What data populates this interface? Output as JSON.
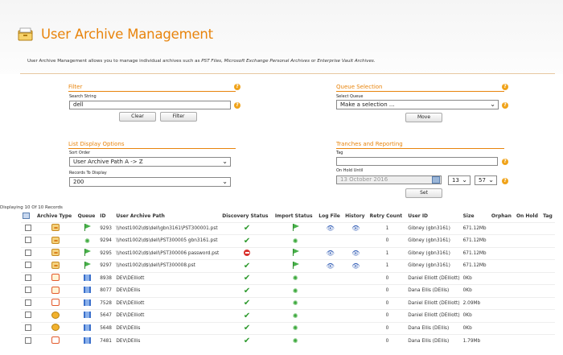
{
  "page": {
    "title": "User Archive Management",
    "description_prefix": "User Archive Management allows you to manage individual archives such as ",
    "description_pst": "PST Files, Microsoft Exchange Personal Archives",
    "description_or": " or ",
    "description_ev": "Enterprise Vault Archives.",
    "accent_color": "#e8840c"
  },
  "filter": {
    "title": "Filter",
    "search_label": "Search String",
    "search_value": "dell",
    "clear_label": "Clear",
    "filter_label": "Filter"
  },
  "queue": {
    "title": "Queue Selection",
    "select_label": "Select Queue",
    "select_value": "Make a selection ...",
    "move_label": "Move"
  },
  "display": {
    "title": "List Display Options",
    "sort_label": "Sort Order",
    "sort_value": "User Archive Path A -> Z",
    "records_label": "Records To Display",
    "records_value": "200"
  },
  "tranches": {
    "title": "Tranches and Reporting",
    "tag_label": "Tag",
    "tag_value": "",
    "hold_label": "On Hold Until",
    "hold_date": "13 October 2016",
    "hour": "13",
    "minute": "57",
    "set_label": "Set"
  },
  "help_glyph": "?",
  "records_count": "Displaying 10 Of 10 Records",
  "table": {
    "columns": [
      "Archive Type",
      "Queue",
      "ID",
      "User Archive Path",
      "Discovery Status",
      "Import Status",
      "Log File",
      "History",
      "Retry Count",
      "User ID",
      "Size",
      "Orphan",
      "On Hold",
      "Tag"
    ],
    "rows": [
      {
        "type": "pst",
        "queue": "flag",
        "id": "9293",
        "path": "\\\\host1002\\d$\\dell\\gbn3161\\PST300001.pst",
        "discovery": "check",
        "import": "flag",
        "log": true,
        "history": true,
        "retry": "1",
        "user": "Gibney (gbn3161)",
        "size": "671.12Mb"
      },
      {
        "type": "pst",
        "queue": "gear",
        "id": "9294",
        "path": "\\\\host1002\\d$\\dell\\PST300005 gbn3161.pst",
        "discovery": "check",
        "import": "gear",
        "log": false,
        "history": false,
        "retry": "0",
        "user": "Gibney (gbn3161)",
        "size": "671.12Mb"
      },
      {
        "type": "pst",
        "queue": "flag",
        "id": "9295",
        "path": "\\\\host1002\\d$\\dell\\PST300006 password.pst",
        "discovery": "deny",
        "import": "flag",
        "log": true,
        "history": true,
        "retry": "1",
        "user": "Gibney (gbn3161)",
        "size": "671.12Mb"
      },
      {
        "type": "pst",
        "queue": "flag",
        "id": "9297",
        "path": "\\\\host1002\\d$\\dell\\PST300008.pst",
        "discovery": "check",
        "import": "flag",
        "log": true,
        "history": true,
        "retry": "1",
        "user": "Gibney (gbn3161)",
        "size": "671.12Mb"
      },
      {
        "type": "mbx2",
        "queue": "user",
        "id": "8938",
        "path": "DEV\\DElliott",
        "discovery": "check",
        "import": "gear",
        "log": false,
        "history": false,
        "retry": "0",
        "user": "Daniel Elliott (DElliott)",
        "size": "0Kb"
      },
      {
        "type": "mbx2",
        "queue": "user",
        "id": "8077",
        "path": "DEV\\DEllis",
        "discovery": "check",
        "import": "gear",
        "log": false,
        "history": false,
        "retry": "0",
        "user": "Dana Ellis (DEllis)",
        "size": "0Kb"
      },
      {
        "type": "mbx",
        "queue": "user",
        "id": "7528",
        "path": "DEV\\DElliott",
        "discovery": "check",
        "import": "gear",
        "log": false,
        "history": false,
        "retry": "0",
        "user": "Daniel Elliott (DElliott)",
        "size": "2.09Mb"
      },
      {
        "type": "ev",
        "queue": "user",
        "id": "5647",
        "path": "DEV\\DElliott",
        "discovery": "check",
        "import": "gear",
        "log": false,
        "history": false,
        "retry": "0",
        "user": "Daniel Elliott (DElliott)",
        "size": "0Kb"
      },
      {
        "type": "ev",
        "queue": "user",
        "id": "5648",
        "path": "DEV\\DEllis",
        "discovery": "check",
        "import": "gear",
        "log": false,
        "history": false,
        "retry": "0",
        "user": "Dana Ellis (DEllis)",
        "size": "0Kb"
      },
      {
        "type": "mbx",
        "queue": "user",
        "id": "7481",
        "path": "DEV\\DEllis",
        "discovery": "check",
        "import": "gear",
        "log": false,
        "history": false,
        "retry": "0",
        "user": "Dana Ellis (DEllis)",
        "size": "1.79Mb"
      }
    ]
  }
}
